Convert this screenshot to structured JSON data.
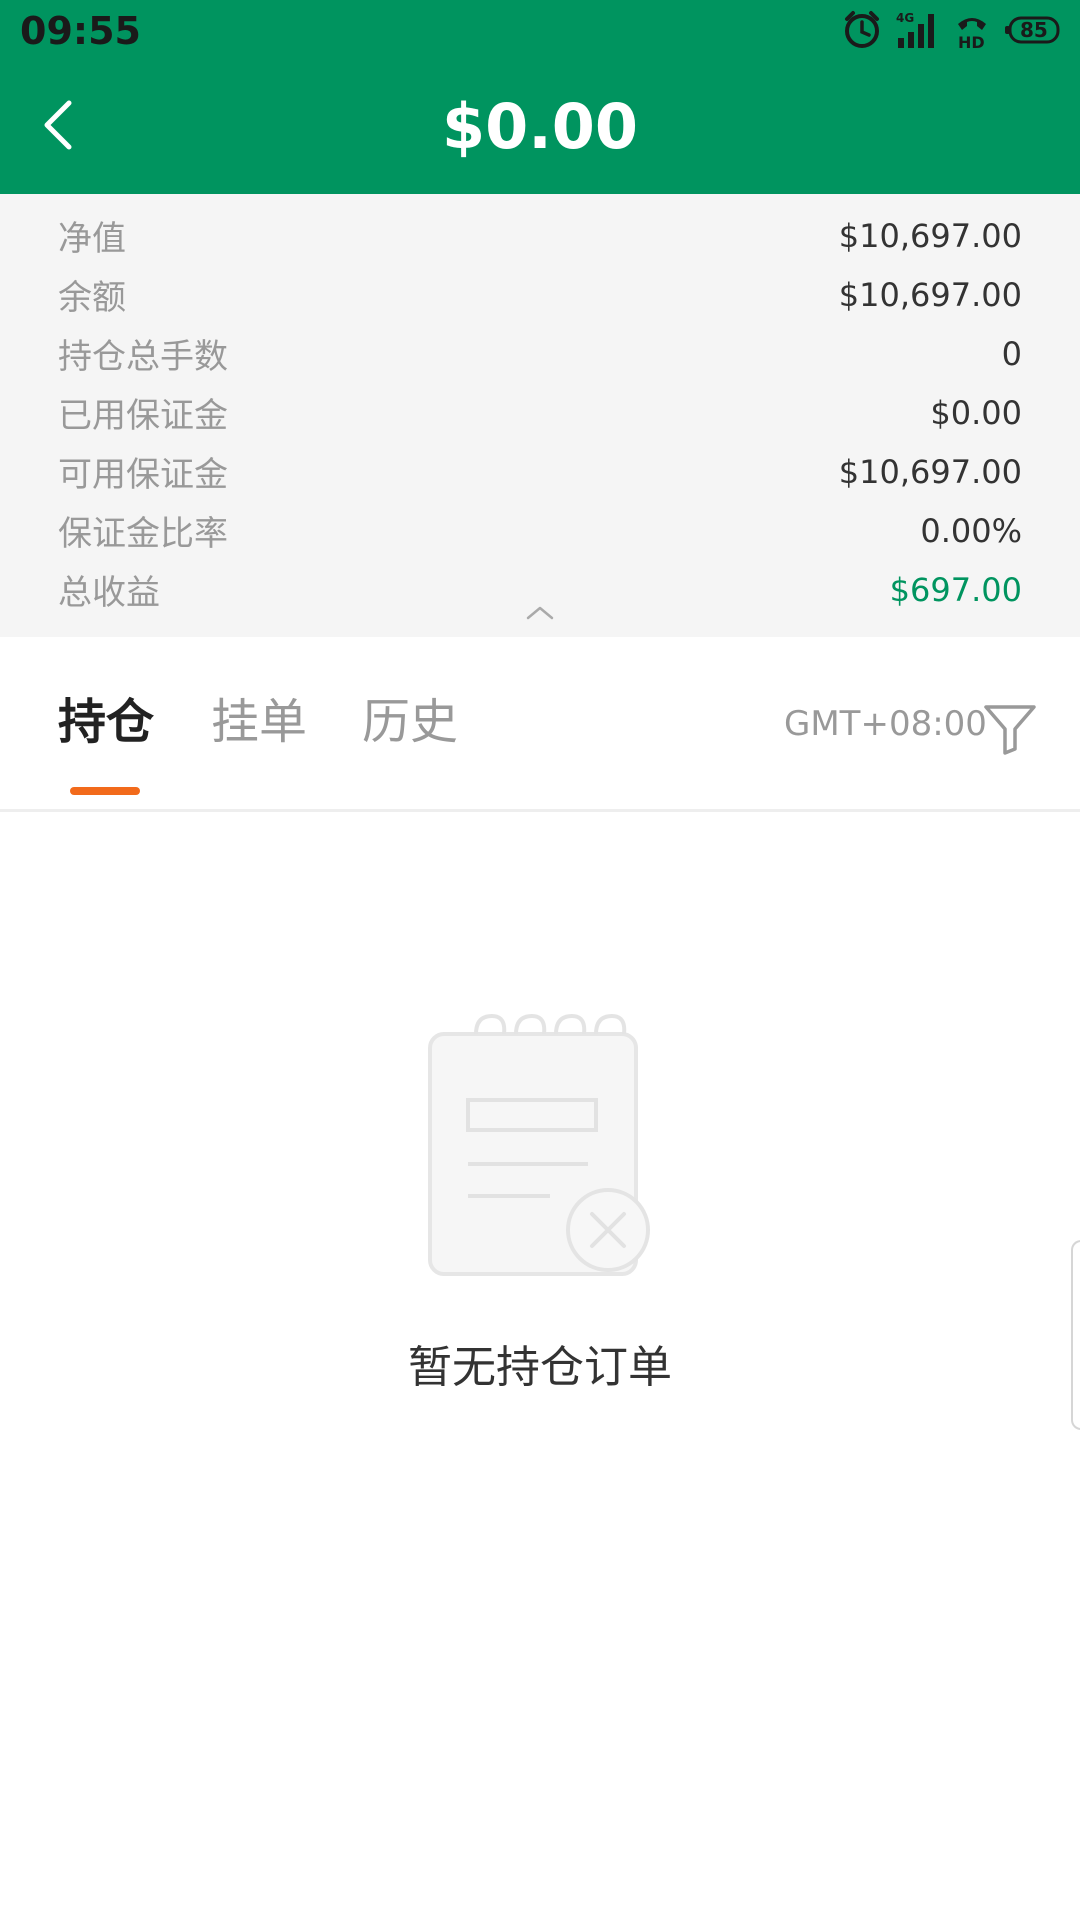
{
  "status_bar": {
    "time": "09:55",
    "battery_level": "85",
    "icons": [
      "alarm-icon",
      "signal-4g-icon",
      "hd-call-icon",
      "battery-icon"
    ]
  },
  "header": {
    "title": "$0.00",
    "back_icon": "chevron-left-icon",
    "background_color": "#00945f"
  },
  "summary": {
    "rows": [
      {
        "label": "净值",
        "value": "$10,697.00"
      },
      {
        "label": "余额",
        "value": "$10,697.00"
      },
      {
        "label": "持仓总手数",
        "value": "0"
      },
      {
        "label": "已用保证金",
        "value": "$0.00"
      },
      {
        "label": "可用保证金",
        "value": "$10,697.00"
      },
      {
        "label": "保证金比率",
        "value": "0.00%"
      },
      {
        "label": "总收益",
        "value": "$697.00"
      }
    ],
    "collapse_icon": "chevron-up-icon",
    "positive_color": "#00945f"
  },
  "tabs": {
    "items": [
      {
        "label": "持仓",
        "active": true
      },
      {
        "label": "挂单",
        "active": false
      },
      {
        "label": "历史",
        "active": false
      }
    ],
    "indicator_color": "#f26a1b",
    "timezone": "GMT+08:00",
    "filter_icon": "filter-icon"
  },
  "empty_state": {
    "icon": "empty-notepad-icon",
    "message": "暂无持仓订单"
  }
}
